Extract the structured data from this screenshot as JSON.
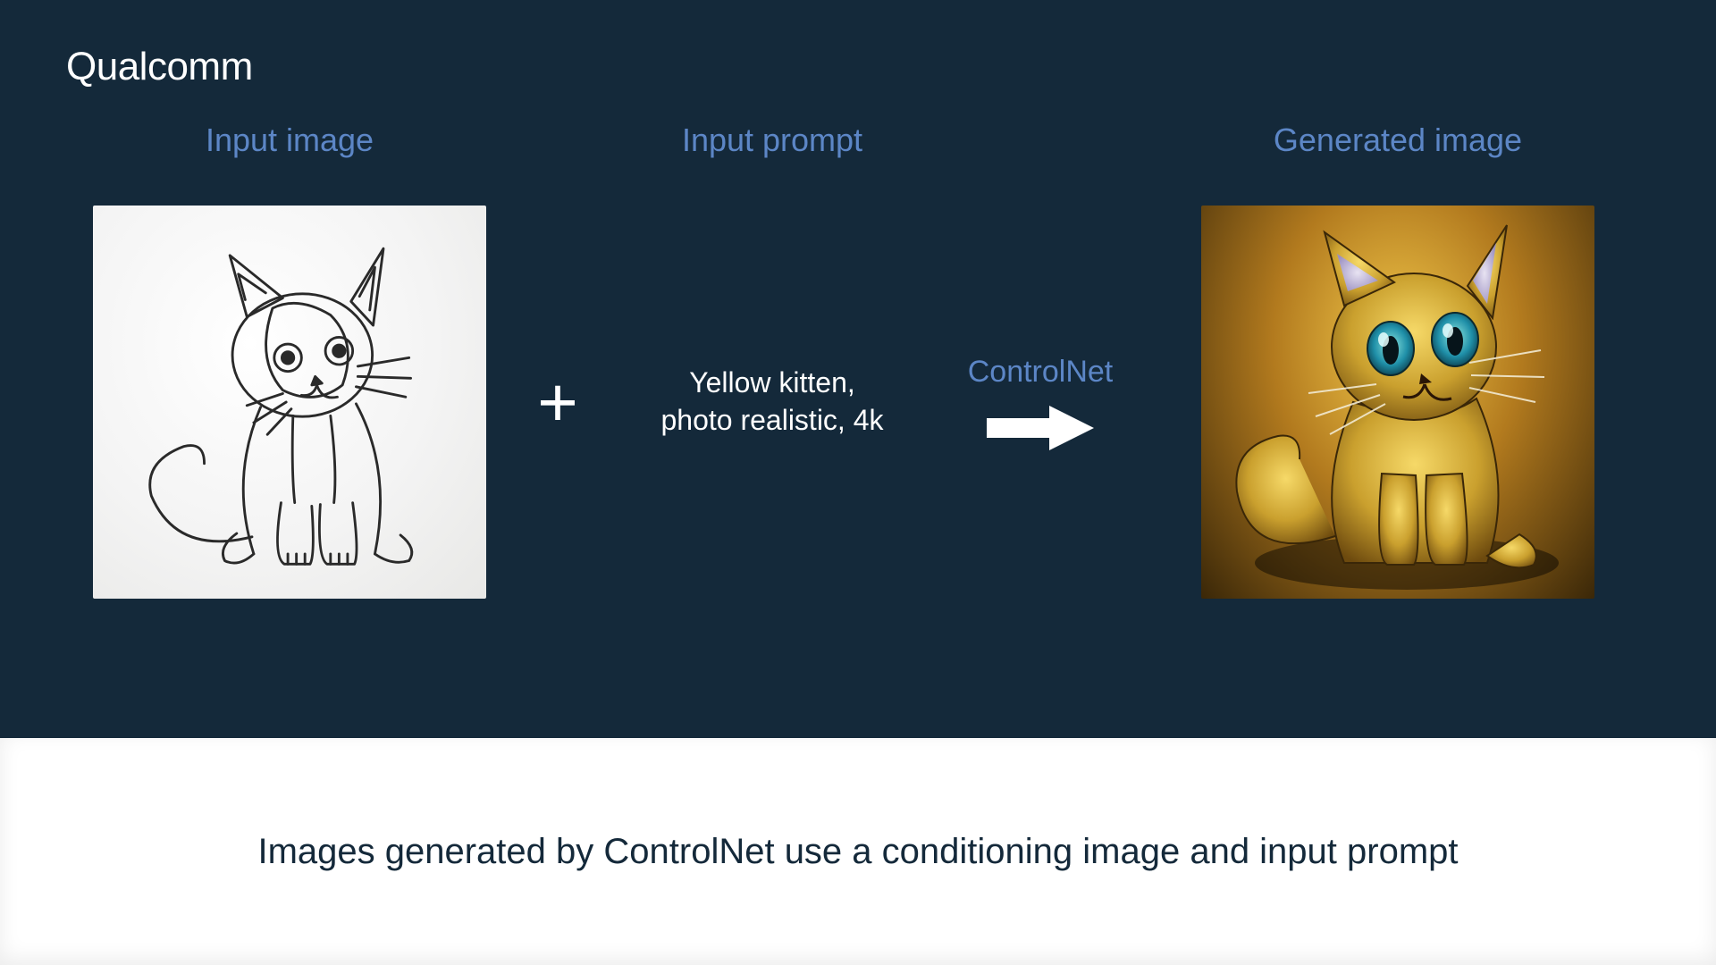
{
  "brand": "Qualcomm",
  "headers": {
    "input_image": "Input image",
    "input_prompt": "Input prompt",
    "generated_image": "Generated image"
  },
  "operators": {
    "plus": "+",
    "arrow_label": "ControlNet"
  },
  "prompt_text": "Yellow kitten,\nphoto realistic, 4k",
  "caption": "Images generated by ControlNet use a conditioning image and input prompt",
  "colors": {
    "accent": "#5c86c6",
    "bg_dark": "#14293a",
    "white": "#ffffff"
  }
}
